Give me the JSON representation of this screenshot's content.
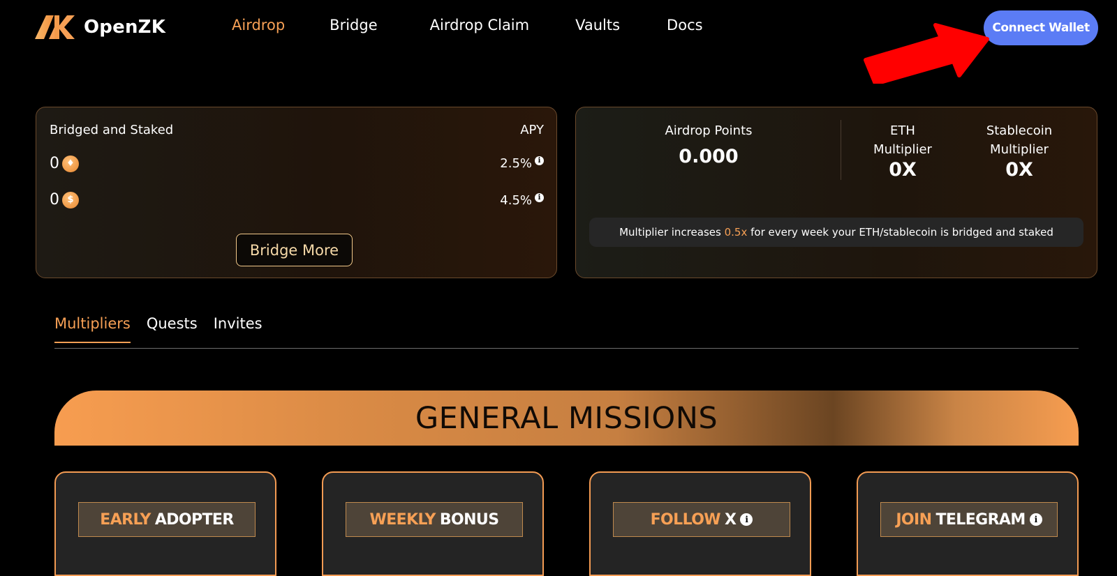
{
  "app": {
    "name": "OpenZK"
  },
  "nav": {
    "items": [
      {
        "label": "Airdrop",
        "active": true
      },
      {
        "label": "Bridge",
        "active": false
      },
      {
        "label": "Airdrop Claim",
        "active": false
      },
      {
        "label": "Vaults",
        "active": false
      },
      {
        "label": "Docs",
        "active": false
      }
    ]
  },
  "header": {
    "connect_label": "Connect Wallet"
  },
  "staked_card": {
    "title": "Bridged and Staked",
    "apy_label": "APY",
    "rows": [
      {
        "amount": "0",
        "coin_icon": "eth-coin-icon",
        "coin_glyph": "♦",
        "apy": "2.5%"
      },
      {
        "amount": "0",
        "coin_icon": "dollar-coin-icon",
        "coin_glyph": "$",
        "apy": "4.5%"
      }
    ],
    "bridge_more_label": "Bridge More"
  },
  "points_card": {
    "points_label": "Airdrop Points",
    "points_value": "0.000",
    "eth_label_line1": "ETH",
    "eth_label_line2": "Multiplier",
    "eth_value": "0X",
    "stable_label_line1": "Stablecoin",
    "stable_label_line2": "Multiplier",
    "stable_value": "0X",
    "note_prefix": "Multiplier increases",
    "note_highlight": "0.5x",
    "note_suffix": "for every week your ETH/stablecoin is bridged and staked"
  },
  "tabs": [
    {
      "label": "Multipliers",
      "active": true
    },
    {
      "label": "Quests",
      "active": false
    },
    {
      "label": "Invites",
      "active": false
    }
  ],
  "missions": {
    "banner_title": "GENERAL MISSIONS",
    "cards": [
      {
        "accent": "EARLY",
        "rest": "ADOPTER",
        "info": false
      },
      {
        "accent": "WEEKLY",
        "rest": "BONUS",
        "info": false
      },
      {
        "accent": "FOLLOW",
        "rest": "X",
        "info": true
      },
      {
        "accent": "JOIN",
        "rest": "TELEGRAM",
        "info": true
      }
    ]
  },
  "colors": {
    "accent": "#f7a055",
    "connect_button": "#5b7cf5",
    "background": "#000000",
    "annotation_arrow": "#ff0000"
  }
}
